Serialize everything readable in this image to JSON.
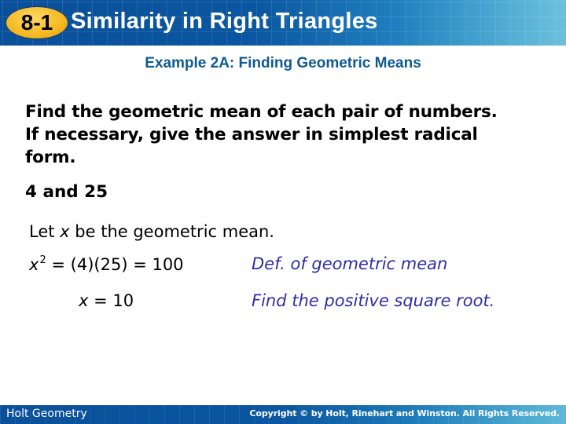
{
  "header": {
    "lesson_badge": "8-1",
    "title": "Similarity in Right Triangles",
    "colors": {
      "banner_blue": "#0b56a0",
      "banner_light": "#6cc0dc",
      "badge_gold": "#f5b820"
    }
  },
  "example": {
    "subtitle": "Example 2A: Finding Geometric Means",
    "subtitle_color": "#0e5a94",
    "prompt_lines": [
      "Find the geometric mean of each pair of numbers.",
      "If necessary, give the answer in simplest radical",
      "form."
    ],
    "pair": "4 and 25"
  },
  "solution": {
    "let_prefix": "Let ",
    "let_var": "x",
    "let_suffix": " be the geometric mean.",
    "steps": [
      {
        "var": "x",
        "exponent": "2",
        "equation": " = (4)(25) = 100",
        "reason": "Def. of geometric mean"
      },
      {
        "var": "x",
        "equation": " = 10",
        "reason": "Find the positive square root."
      }
    ],
    "reason_color": "#2e2ea6"
  },
  "footer": {
    "left": "Holt Geometry",
    "right": "Copyright © by Holt, Rinehart and Winston. All Rights Reserved."
  }
}
